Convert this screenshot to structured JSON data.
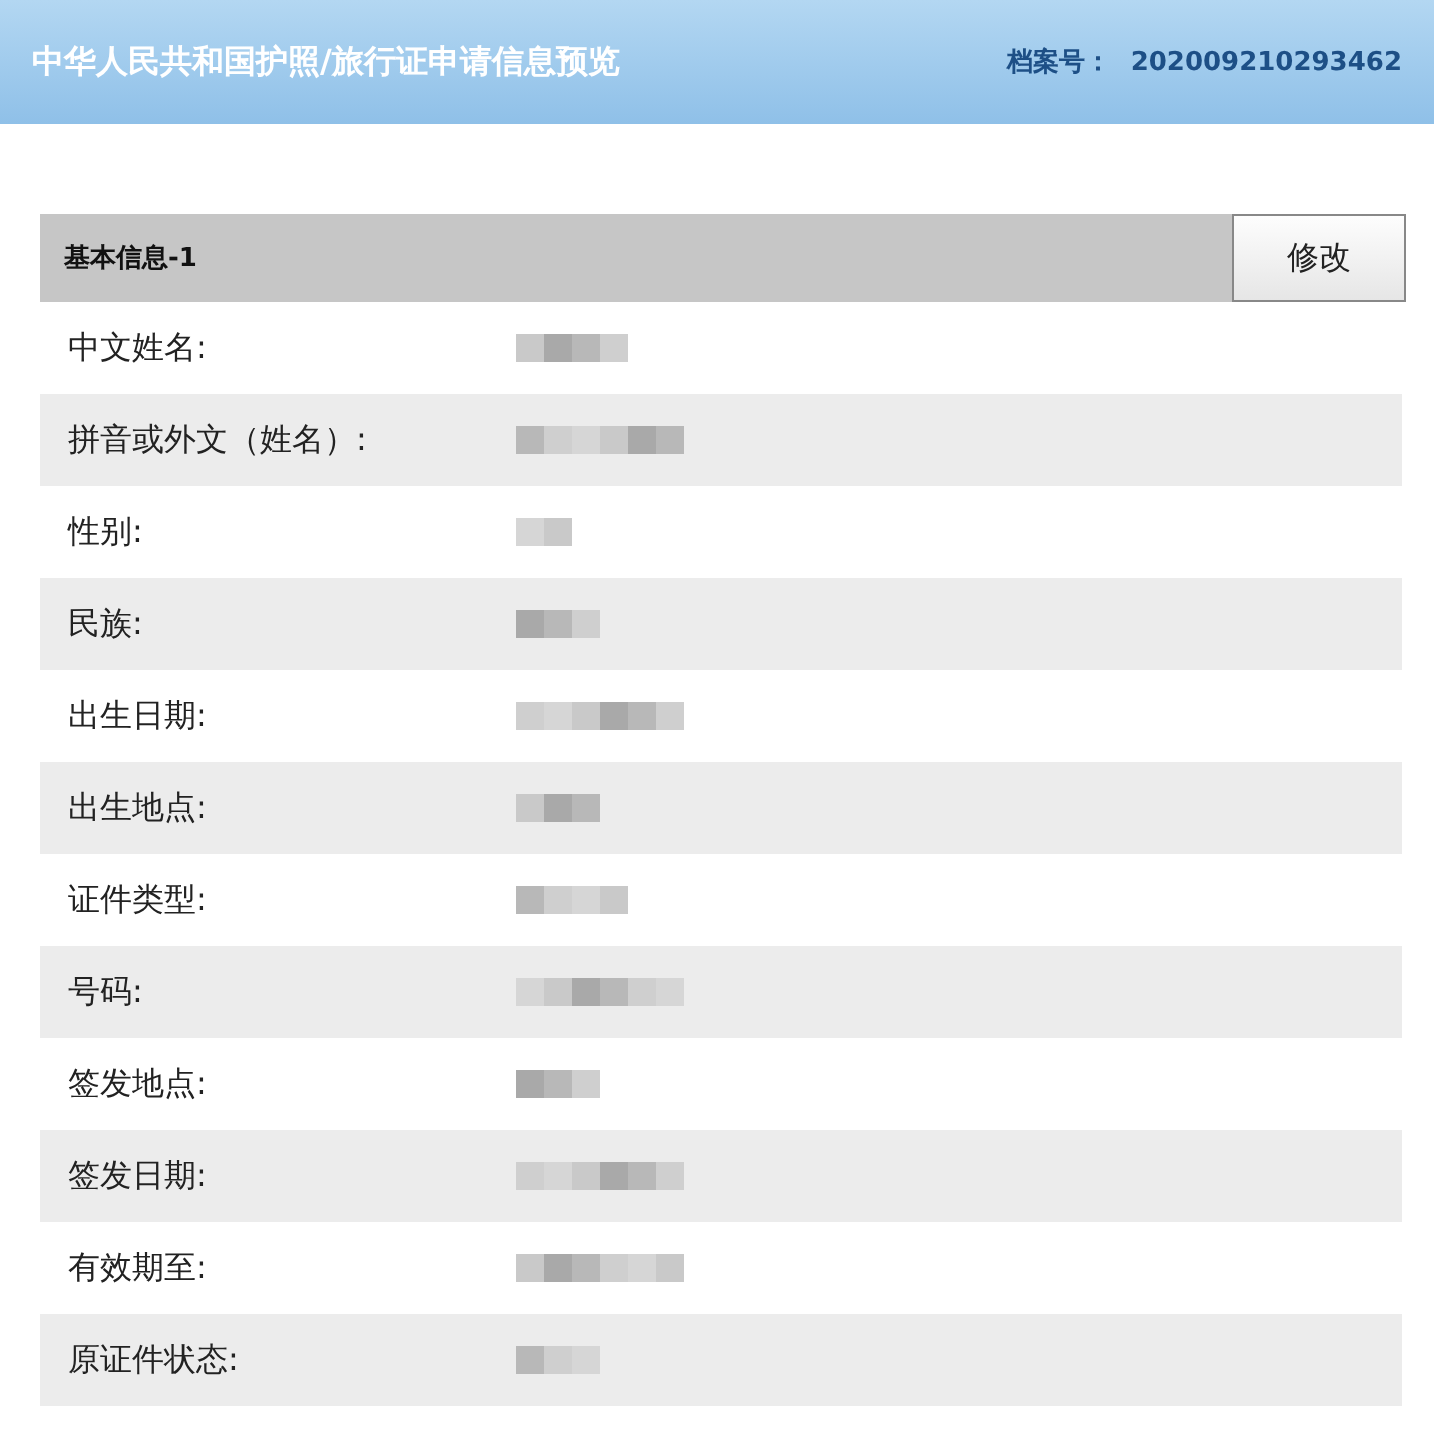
{
  "header": {
    "title": "中华人民共和国护照/旅行证申请信息预览",
    "file_label": "档案号：",
    "file_number": "202009210293462"
  },
  "section": {
    "title": "基本信息-1",
    "edit_button": "修改",
    "rows": [
      {
        "label": "中文姓名:"
      },
      {
        "label": "拼音或外文（姓名）:"
      },
      {
        "label": "性别:"
      },
      {
        "label": "民族:"
      },
      {
        "label": "出生日期:"
      },
      {
        "label": "出生地点:"
      },
      {
        "label": "证件类型:"
      },
      {
        "label": "号码:"
      },
      {
        "label": "签发地点:"
      },
      {
        "label": "签发日期:"
      },
      {
        "label": "有效期至:"
      },
      {
        "label": "原证件状态:"
      }
    ]
  }
}
